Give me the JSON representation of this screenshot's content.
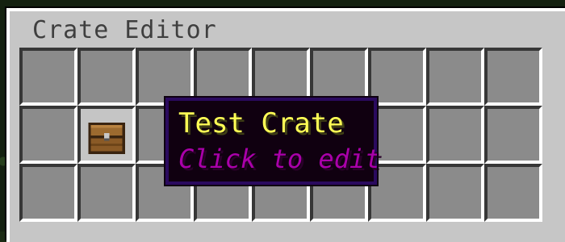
{
  "window": {
    "title": "Crate Editor"
  },
  "grid": {
    "columns": 9,
    "visible_rows": 3
  },
  "items": [
    {
      "slot_row": 2,
      "slot_col": 2,
      "icon": "chest-icon",
      "name": "Test Crate",
      "lore": "Click to edit"
    }
  ],
  "tooltip": {
    "name": "Test Crate",
    "lore": "Click to edit",
    "name_color": "#ffff55",
    "lore_color": "#aa00aa"
  },
  "colors": {
    "panel": "#c6c6c6",
    "slot": "#8b8b8b",
    "tooltip_bg": "#100010",
    "tooltip_border": "#2a0a5e"
  }
}
